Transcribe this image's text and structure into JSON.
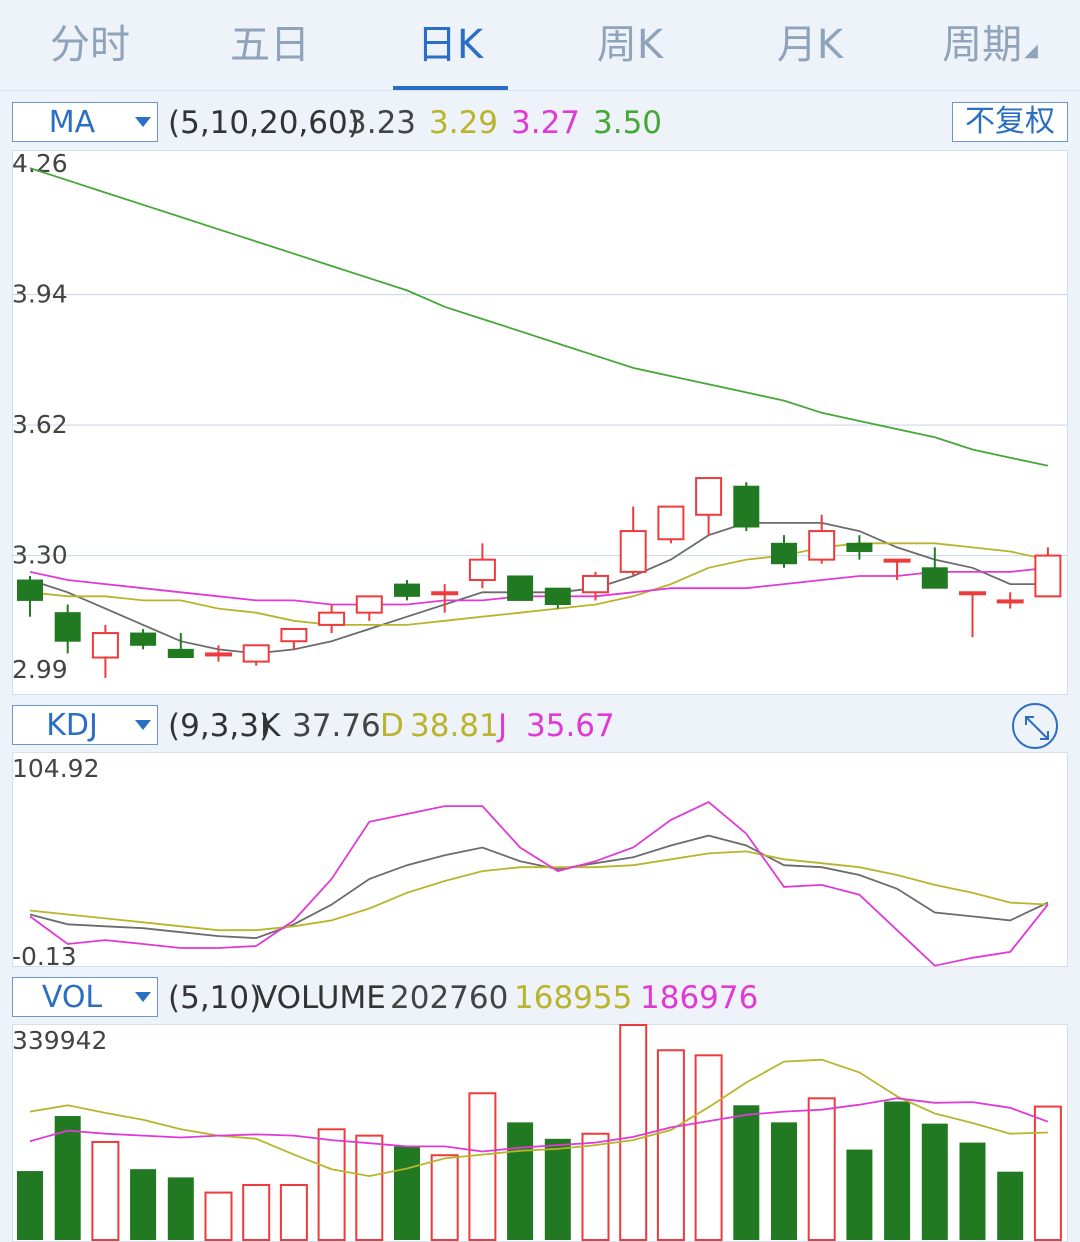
{
  "tabs": [
    {
      "label": "分时",
      "active": false
    },
    {
      "label": "五日",
      "active": false
    },
    {
      "label": "日K",
      "active": true
    },
    {
      "label": "周K",
      "active": false
    },
    {
      "label": "月K",
      "active": false
    },
    {
      "label": "周期",
      "active": false,
      "has_dropdown": true
    }
  ],
  "colors": {
    "up": "#ee3a3a",
    "down": "#217a21",
    "ma5": "#6b6b6b",
    "ma10": "#b9b42b",
    "ma20": "#e03ad6",
    "ma60": "#45a836",
    "accent": "#2b6fc4"
  },
  "price_panel": {
    "selector": "MA",
    "params": "(5,10,20,60)",
    "values": [
      "3.23",
      "3.29",
      "3.27",
      "3.50"
    ],
    "adjust_button": "不复权",
    "y_ticks": [
      "4.26",
      "3.94",
      "3.62",
      "3.30",
      "2.99"
    ]
  },
  "kdj_panel": {
    "selector": "KDJ",
    "params": "(9,3,3)",
    "k_label": "K",
    "k_value": "37.76",
    "d_label": "D",
    "d_value": "38.81",
    "j_label": "J",
    "j_value": "35.67",
    "y_ticks": [
      "104.92",
      "-0.13"
    ],
    "expand_icon": "expand-icon"
  },
  "vol_panel": {
    "selector": "VOL",
    "params": "(5,10)",
    "label": "VOLUME",
    "values": [
      "202760",
      "168955",
      "186976"
    ],
    "y_max": "339942"
  },
  "chart_data": [
    {
      "type": "candlestick",
      "ylim": [
        2.99,
        4.26
      ],
      "candles": [
        {
          "o": 3.24,
          "h": 3.25,
          "l": 3.15,
          "c": 3.19
        },
        {
          "o": 3.16,
          "h": 3.18,
          "l": 3.06,
          "c": 3.09
        },
        {
          "o": 3.05,
          "h": 3.13,
          "l": 3.0,
          "c": 3.11
        },
        {
          "o": 3.11,
          "h": 3.12,
          "l": 3.07,
          "c": 3.08
        },
        {
          "o": 3.07,
          "h": 3.11,
          "l": 3.05,
          "c": 3.05
        },
        {
          "o": 3.06,
          "h": 3.08,
          "l": 3.04,
          "c": 3.06
        },
        {
          "o": 3.04,
          "h": 3.08,
          "l": 3.03,
          "c": 3.08
        },
        {
          "o": 3.09,
          "h": 3.12,
          "l": 3.07,
          "c": 3.12
        },
        {
          "o": 3.13,
          "h": 3.18,
          "l": 3.11,
          "c": 3.16
        },
        {
          "o": 3.16,
          "h": 3.19,
          "l": 3.14,
          "c": 3.2
        },
        {
          "o": 3.23,
          "h": 3.24,
          "l": 3.19,
          "c": 3.2
        },
        {
          "o": 3.21,
          "h": 3.23,
          "l": 3.16,
          "c": 3.21
        },
        {
          "o": 3.24,
          "h": 3.33,
          "l": 3.22,
          "c": 3.29
        },
        {
          "o": 3.25,
          "h": 3.25,
          "l": 3.19,
          "c": 3.19
        },
        {
          "o": 3.22,
          "h": 3.22,
          "l": 3.17,
          "c": 3.18
        },
        {
          "o": 3.21,
          "h": 3.26,
          "l": 3.19,
          "c": 3.25
        },
        {
          "o": 3.26,
          "h": 3.42,
          "l": 3.25,
          "c": 3.36
        },
        {
          "o": 3.34,
          "h": 3.39,
          "l": 3.33,
          "c": 3.42
        },
        {
          "o": 3.4,
          "h": 3.49,
          "l": 3.35,
          "c": 3.49
        },
        {
          "o": 3.47,
          "h": 3.48,
          "l": 3.36,
          "c": 3.37
        },
        {
          "o": 3.33,
          "h": 3.35,
          "l": 3.27,
          "c": 3.28
        },
        {
          "o": 3.29,
          "h": 3.4,
          "l": 3.28,
          "c": 3.36
        },
        {
          "o": 3.33,
          "h": 3.35,
          "l": 3.29,
          "c": 3.31
        },
        {
          "o": 3.29,
          "h": 3.29,
          "l": 3.24,
          "c": 3.29
        },
        {
          "o": 3.27,
          "h": 3.32,
          "l": 3.22,
          "c": 3.22
        },
        {
          "o": 3.21,
          "h": 3.21,
          "l": 3.1,
          "c": 3.21
        },
        {
          "o": 3.19,
          "h": 3.21,
          "l": 3.17,
          "c": 3.19
        },
        {
          "o": 3.2,
          "h": 3.32,
          "l": 3.2,
          "c": 3.3
        }
      ],
      "series": [
        {
          "name": "MA5",
          "values": [
            3.24,
            3.21,
            3.17,
            3.13,
            3.09,
            3.07,
            3.06,
            3.07,
            3.09,
            3.12,
            3.15,
            3.18,
            3.21,
            3.21,
            3.21,
            3.22,
            3.25,
            3.29,
            3.35,
            3.38,
            3.38,
            3.38,
            3.36,
            3.32,
            3.29,
            3.27,
            3.23,
            3.23
          ]
        },
        {
          "name": "MA10",
          "values": [
            3.21,
            3.2,
            3.2,
            3.19,
            3.19,
            3.17,
            3.16,
            3.14,
            3.13,
            3.13,
            3.13,
            3.14,
            3.15,
            3.16,
            3.17,
            3.18,
            3.2,
            3.23,
            3.27,
            3.29,
            3.3,
            3.32,
            3.33,
            3.33,
            3.33,
            3.32,
            3.31,
            3.29
          ]
        },
        {
          "name": "MA20",
          "values": [
            3.26,
            3.24,
            3.23,
            3.22,
            3.21,
            3.2,
            3.19,
            3.19,
            3.18,
            3.18,
            3.18,
            3.19,
            3.19,
            3.2,
            3.2,
            3.2,
            3.21,
            3.22,
            3.22,
            3.22,
            3.23,
            3.24,
            3.25,
            3.25,
            3.26,
            3.26,
            3.26,
            3.27
          ]
        },
        {
          "name": "MA60",
          "values": [
            4.25,
            4.22,
            4.19,
            4.16,
            4.13,
            4.1,
            4.07,
            4.04,
            4.01,
            3.98,
            3.95,
            3.91,
            3.88,
            3.85,
            3.82,
            3.79,
            3.76,
            3.74,
            3.72,
            3.7,
            3.68,
            3.65,
            3.63,
            3.61,
            3.59,
            3.56,
            3.54,
            3.52
          ]
        }
      ]
    },
    {
      "type": "line",
      "ylim": [
        -0.13,
        104.92
      ],
      "series": [
        {
          "name": "K",
          "values": [
            24,
            19,
            18,
            17,
            15,
            13,
            12,
            19,
            29,
            42,
            49,
            54,
            58,
            51,
            47,
            50,
            53,
            59,
            64,
            59,
            49,
            48,
            44,
            37,
            25,
            23,
            21,
            30
          ]
        },
        {
          "name": "D",
          "values": [
            26,
            24,
            22,
            20,
            18,
            16,
            16,
            18,
            21,
            27,
            35,
            41,
            46,
            48,
            48,
            48,
            49,
            52,
            55,
            56,
            52,
            50,
            48,
            44,
            39,
            35,
            30,
            29
          ]
        },
        {
          "name": "J",
          "values": [
            23,
            9,
            11,
            9,
            7,
            7,
            8,
            21,
            42,
            71,
            75,
            79,
            79,
            58,
            46,
            51,
            58,
            72,
            81,
            65,
            38,
            39,
            34,
            16,
            -2,
            2,
            5,
            29
          ]
        }
      ]
    },
    {
      "type": "bar",
      "ylim": [
        0,
        339942
      ],
      "values": [
        109000,
        196000,
        155000,
        112000,
        99000,
        75000,
        87000,
        87000,
        175000,
        165000,
        148000,
        134000,
        232000,
        186000,
        160000,
        168000,
        339942,
        300000,
        292000,
        213000,
        186000,
        224000,
        143000,
        219000,
        184000,
        154000,
        108000,
        211000
      ],
      "up": [
        false,
        false,
        true,
        false,
        false,
        true,
        true,
        true,
        true,
        true,
        false,
        true,
        true,
        false,
        false,
        true,
        true,
        true,
        true,
        false,
        false,
        true,
        false,
        false,
        false,
        false,
        false,
        true
      ],
      "series": [
        {
          "name": "MA5",
          "values": [
            203000,
            213000,
            201000,
            190000,
            175000,
            165000,
            160000,
            135000,
            112000,
            101000,
            113000,
            129000,
            135000,
            141000,
            144000,
            150000,
            158000,
            174000,
            210000,
            249000,
            282000,
            285000,
            265000,
            227000,
            200000,
            185000,
            168000,
            170000
          ]
        },
        {
          "name": "MA10",
          "values": [
            156000,
            173000,
            168000,
            165000,
            162000,
            165000,
            167000,
            165000,
            158000,
            153000,
            148000,
            148000,
            140000,
            146000,
            150000,
            154000,
            163000,
            178000,
            188000,
            198000,
            203000,
            206000,
            214000,
            224000,
            217000,
            218000,
            209000,
            187000
          ]
        }
      ]
    }
  ]
}
